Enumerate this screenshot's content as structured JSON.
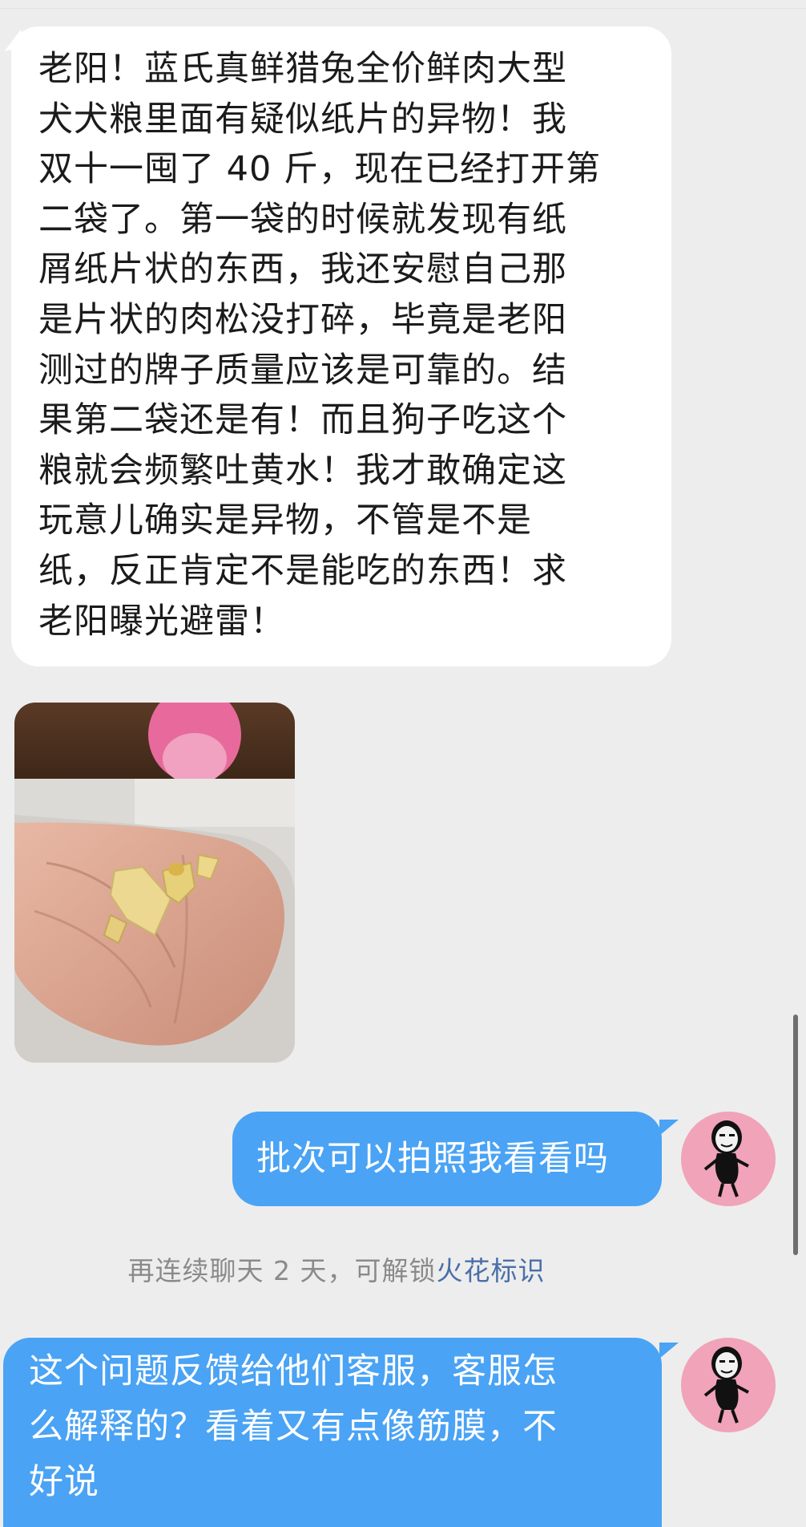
{
  "messages": [
    {
      "direction": "incoming",
      "text": "老阳！蓝氏真鲜猎兔全价鲜肉大型\n犬犬粮里面有疑似纸片的异物！我\n双十一囤了 40 斤，现在已经打开第\n二袋了。第一袋的时候就发现有纸\n屑纸片状的东西，我还安慰自己那\n是片状的肉松没打碎，毕竟是老阳\n测过的牌子质量应该是可靠的。结\n果第二袋还是有！而且狗子吃这个\n粮就会频繁吐黄水！我才敢确定这\n玩意儿确实是异物，不管是不是\n纸，反正肯定不是能吃的东西！求\n老阳曝光避雷！"
    },
    {
      "direction": "outgoing",
      "text": "批次可以拍照我看看吗"
    },
    {
      "direction": "outgoing",
      "text": "这个问题反馈给他们客服，客服怎\n么解释的？看着又有点像筋膜，不\n好说"
    }
  ],
  "system_notice": {
    "text": "再连续聊天 2 天，可解锁",
    "link": "火花标识"
  },
  "colors": {
    "background": "#ededed",
    "incoming_bubble": "#ffffff",
    "outgoing_bubble": "#4aa3f4",
    "avatar_bg": "#f0a3b9",
    "link": "#4a6fa8"
  },
  "icons": {
    "avatar": "meme-face-avatar-icon",
    "photo": "palm-with-flakes-photo"
  }
}
